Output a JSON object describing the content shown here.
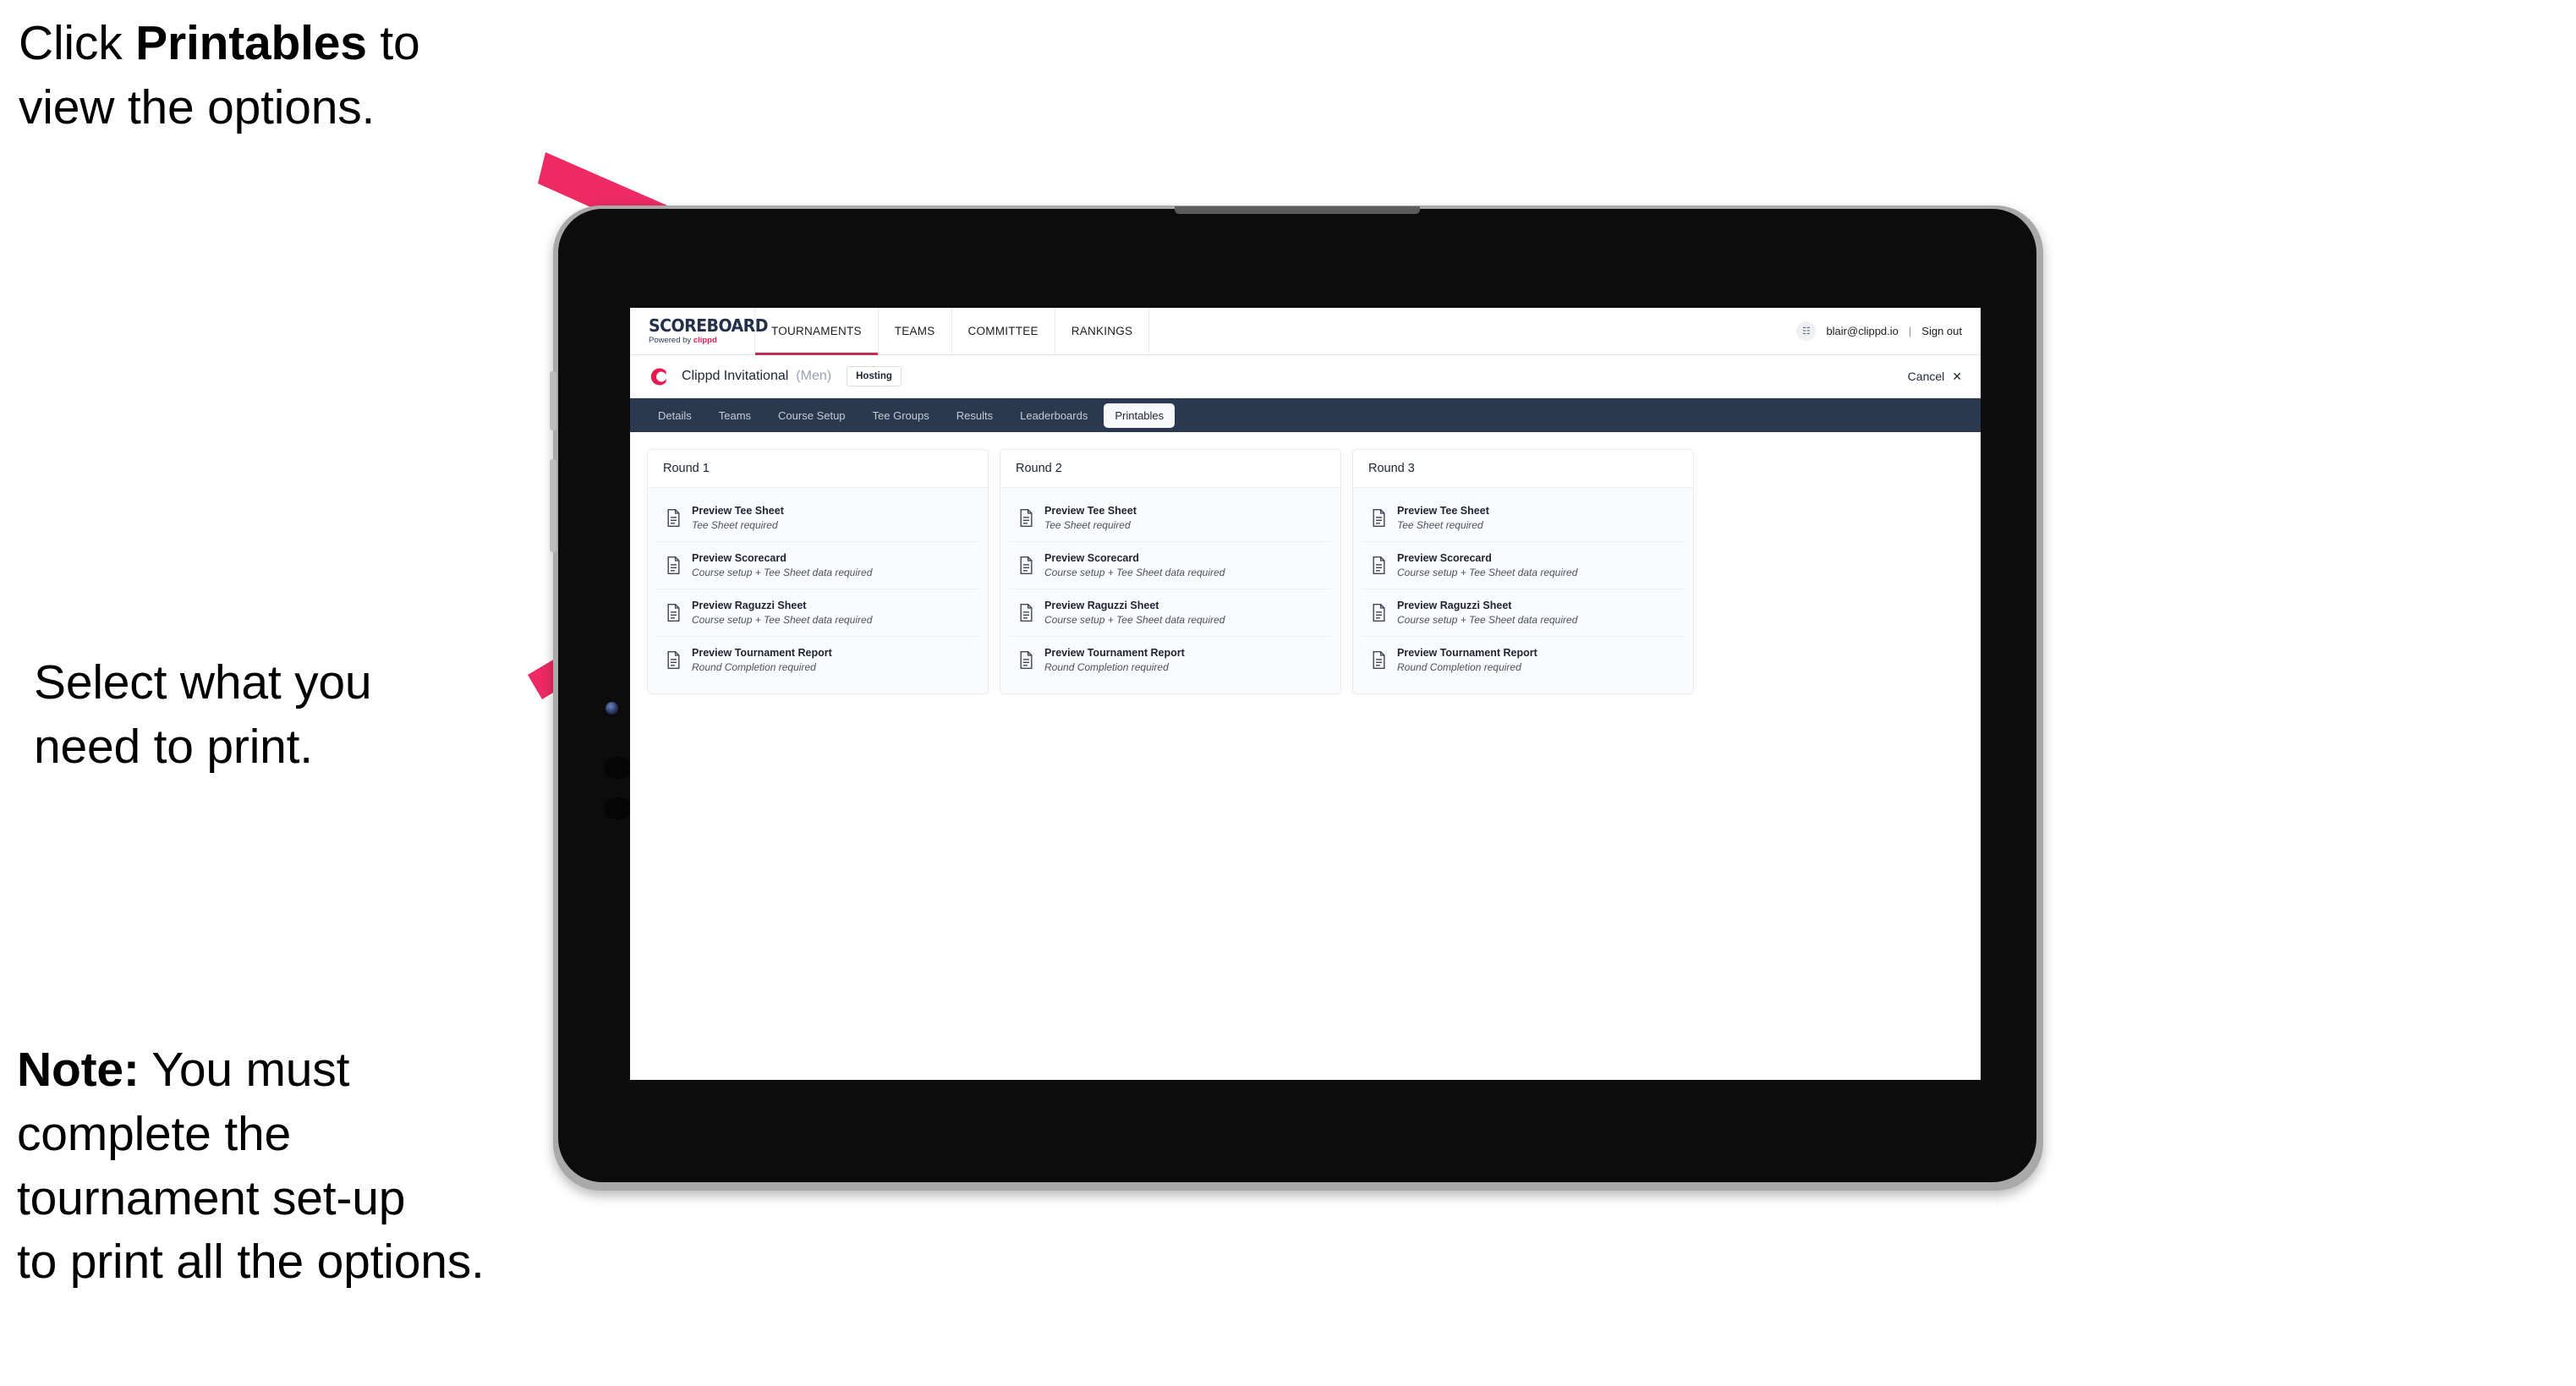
{
  "annotations": {
    "step1_pre": "Click ",
    "step1_bold": "Printables",
    "step1_post": " to\nview the options.",
    "step2": "Select what you\n need to print.",
    "step3_bold": "Note:",
    "step3_rest": " You must\ncomplete the\ntournament set-up\nto print all the options."
  },
  "colors": {
    "arrow_pink": "#ED2A63",
    "navy": "#2B3950",
    "brand_red": "#E8194F",
    "accent_underline": "#C22B55"
  },
  "app": {
    "brand": {
      "name": "SCOREBOARD",
      "powered_prefix": "Powered by ",
      "powered_brand": "clippd"
    },
    "topnav": {
      "links": [
        {
          "label": "TOURNAMENTS",
          "active": true
        },
        {
          "label": "TEAMS",
          "active": false
        },
        {
          "label": "COMMITTEE",
          "active": false
        },
        {
          "label": "RANKINGS",
          "active": false
        }
      ],
      "avatar_glyph": "☷",
      "email": "blair@clippd.io",
      "separator": "|",
      "sign_out": "Sign out"
    },
    "tournament": {
      "logo_letter": "C",
      "name": "Clippd Invitational",
      "gender": "(Men)",
      "status_chip": "Hosting",
      "cancel_label": "Cancel",
      "cancel_icon": "✕"
    },
    "tabs": [
      {
        "label": "Details",
        "active": false
      },
      {
        "label": "Teams",
        "active": false
      },
      {
        "label": "Course Setup",
        "active": false
      },
      {
        "label": "Tee Groups",
        "active": false
      },
      {
        "label": "Results",
        "active": false
      },
      {
        "label": "Leaderboards",
        "active": false
      },
      {
        "label": "Printables",
        "active": true
      }
    ],
    "rounds": [
      {
        "title": "Round 1",
        "items": [
          {
            "title": "Preview Tee Sheet",
            "sub": "Tee Sheet required"
          },
          {
            "title": "Preview Scorecard",
            "sub": "Course setup + Tee Sheet data required"
          },
          {
            "title": "Preview Raguzzi Sheet",
            "sub": "Course setup + Tee Sheet data required"
          },
          {
            "title": "Preview Tournament Report",
            "sub": "Round Completion required"
          }
        ]
      },
      {
        "title": "Round 2",
        "items": [
          {
            "title": "Preview Tee Sheet",
            "sub": "Tee Sheet required"
          },
          {
            "title": "Preview Scorecard",
            "sub": "Course setup + Tee Sheet data required"
          },
          {
            "title": "Preview Raguzzi Sheet",
            "sub": "Course setup + Tee Sheet data required"
          },
          {
            "title": "Preview Tournament Report",
            "sub": "Round Completion required"
          }
        ]
      },
      {
        "title": "Round 3",
        "items": [
          {
            "title": "Preview Tee Sheet",
            "sub": "Tee Sheet required"
          },
          {
            "title": "Preview Scorecard",
            "sub": "Course setup + Tee Sheet data required"
          },
          {
            "title": "Preview Raguzzi Sheet",
            "sub": "Course setup + Tee Sheet data required"
          },
          {
            "title": "Preview Tournament Report",
            "sub": "Round Completion required"
          }
        ]
      }
    ]
  }
}
